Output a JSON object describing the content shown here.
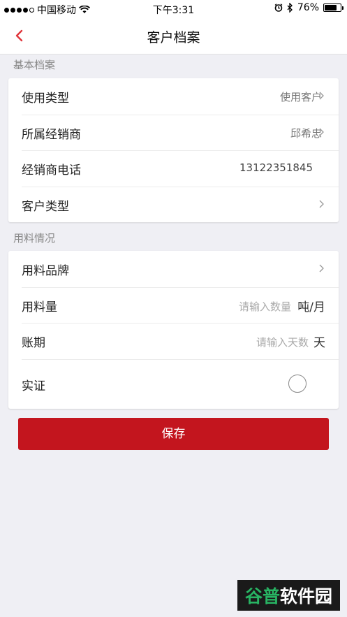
{
  "status_bar": {
    "carrier": "中国移动",
    "time": "下午3:31",
    "battery_percent": "76%",
    "battery_level": 0.76,
    "icons": [
      "signal-dots",
      "wifi-icon",
      "alarm-icon",
      "bluetooth-icon",
      "battery-icon"
    ]
  },
  "nav": {
    "back_icon": "chevron-left-icon",
    "title": "客户档案",
    "accent": "#e0363b"
  },
  "basic": {
    "section_label": "基本档案",
    "rows": [
      {
        "label": "使用类型",
        "value": "使用客户"
      },
      {
        "label": "所属经销商",
        "value": "邱希忠"
      },
      {
        "label": "经销商电话",
        "value": "13122351845"
      },
      {
        "label": "客户类型",
        "value": ""
      }
    ]
  },
  "usage": {
    "section_label": "用料情况",
    "brand_label": "用料品牌",
    "quantity_label": "用料量",
    "quantity_placeholder": "请输入数量",
    "quantity_unit": "吨/月",
    "period_label": "账期",
    "period_placeholder": "请输入天数",
    "period_unit": "天",
    "verified_label": "实证",
    "verified_checked": false
  },
  "save": {
    "label": "保存",
    "color": "#c3151e"
  },
  "watermark": {
    "part1": "谷普",
    "part2": "软件园"
  }
}
